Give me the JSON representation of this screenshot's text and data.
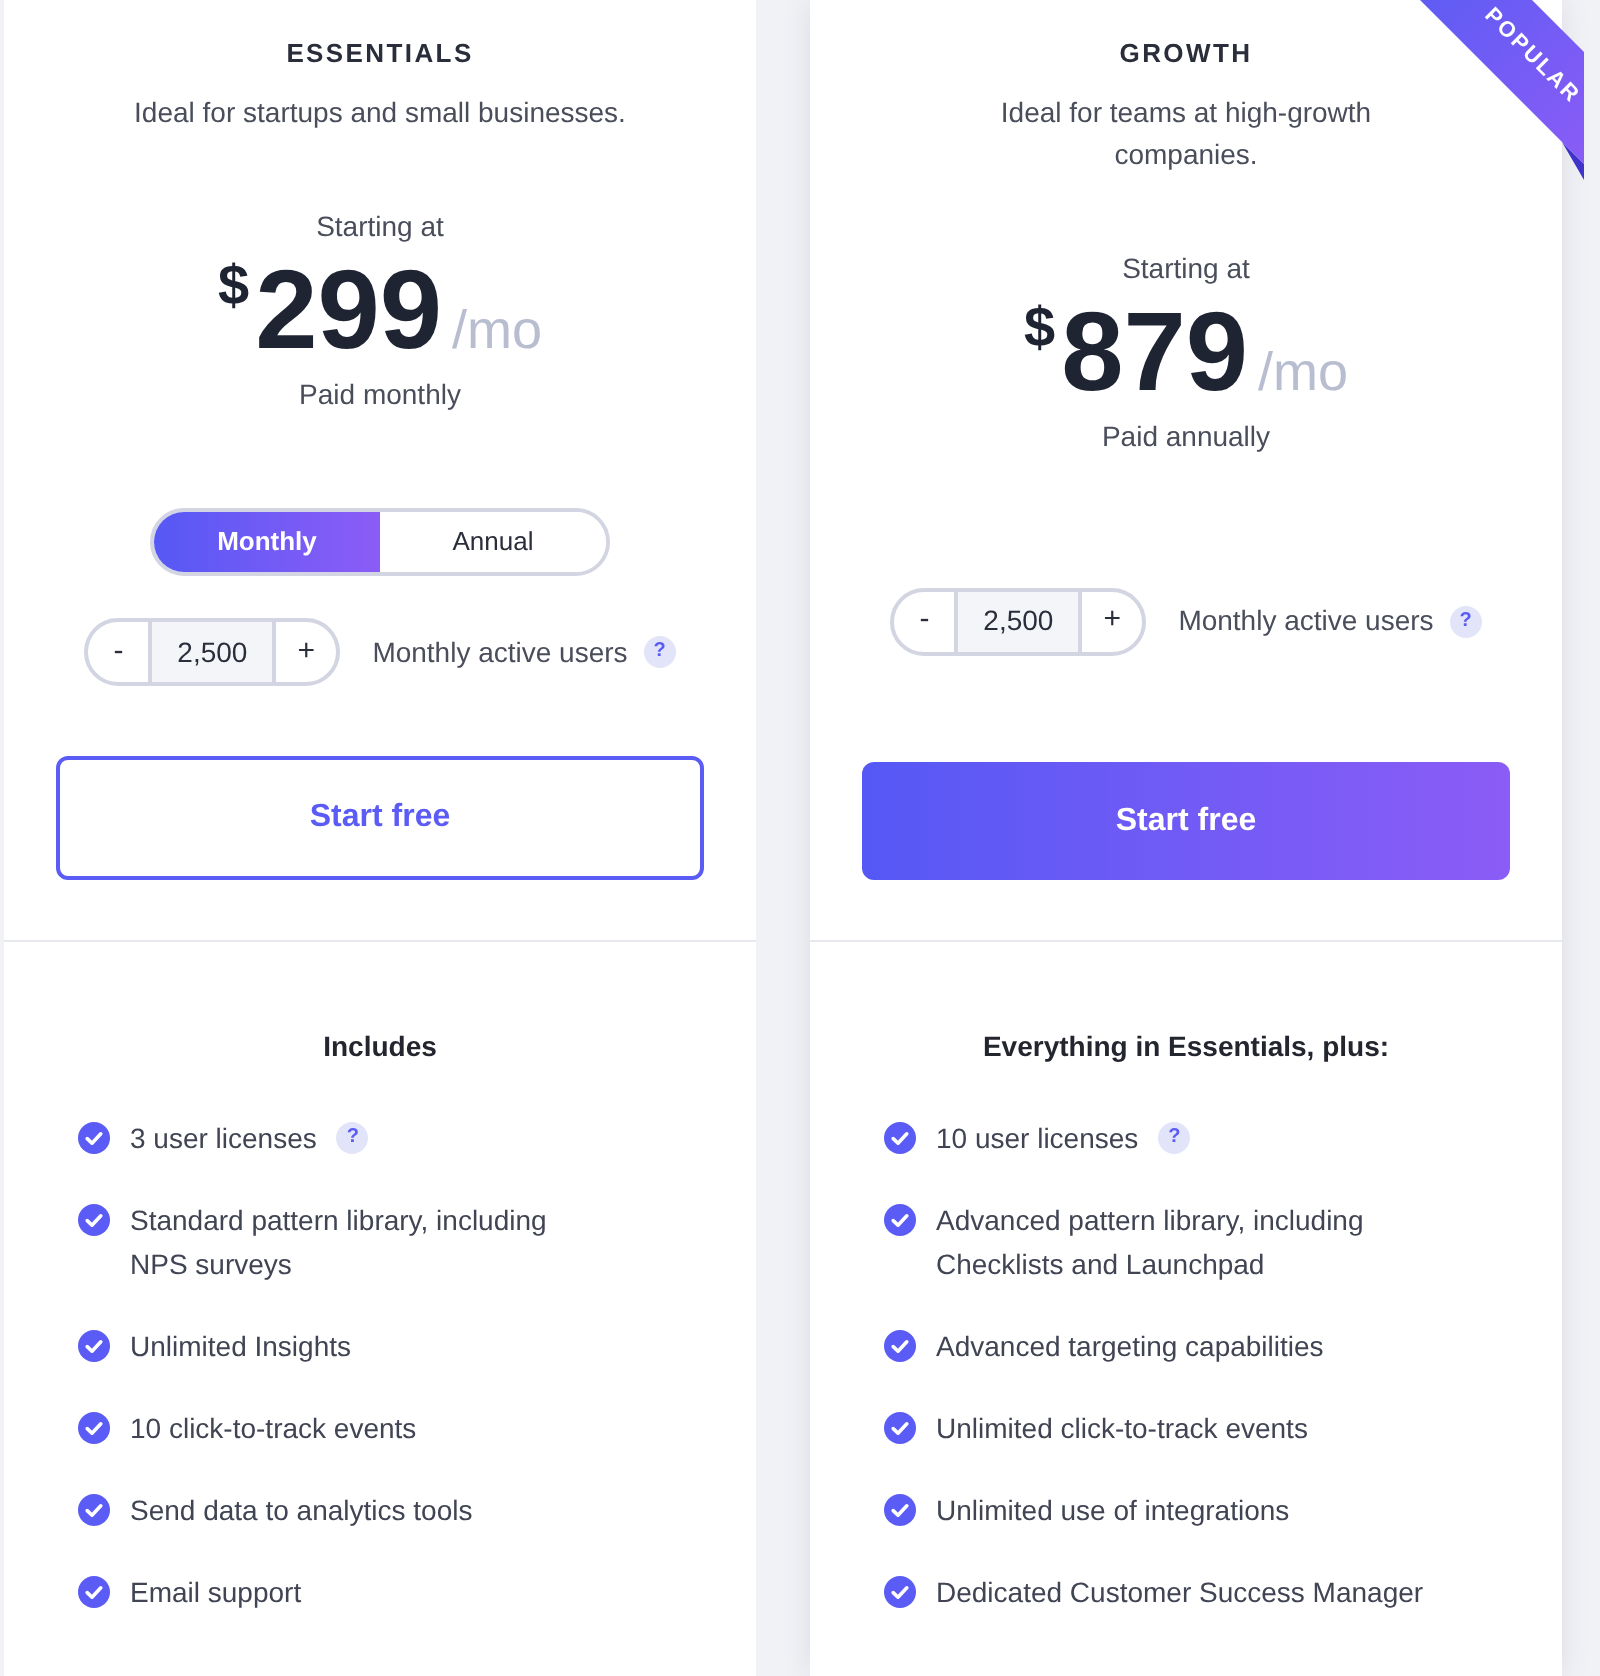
{
  "plans": [
    {
      "name": "ESSENTIALS",
      "subtitle": "Ideal for startups and small businesses.",
      "price_caption": "Starting at",
      "currency": "$",
      "price": "299",
      "period": "/mo",
      "billing_note": "Paid monthly",
      "billing_toggle": [
        {
          "label": "Monthly",
          "selected": true
        },
        {
          "label": "Annual",
          "selected": false
        }
      ],
      "users": {
        "decrement": "-",
        "value": "2,500",
        "increment": "+",
        "label": "Monthly active users",
        "help": "?"
      },
      "cta": {
        "label": "Start free",
        "kind": "outline"
      },
      "features_heading": "Includes",
      "features": [
        {
          "text": "3 user licenses",
          "help": "?"
        },
        {
          "text": "Standard pattern library, including NPS surveys"
        },
        {
          "text": "Unlimited Insights"
        },
        {
          "text": "10 click-to-track events"
        },
        {
          "text": "Send data to analytics tools"
        },
        {
          "text": "Email support"
        }
      ]
    },
    {
      "name": "GROWTH",
      "ribbon": "POPULAR",
      "subtitle": "Ideal for teams at high-growth companies.",
      "price_caption": "Starting at",
      "currency": "$",
      "price": "879",
      "period": "/mo",
      "billing_note": "Paid annually",
      "users": {
        "decrement": "-",
        "value": "2,500",
        "increment": "+",
        "label": "Monthly active users",
        "help": "?"
      },
      "cta": {
        "label": "Start free",
        "kind": "filled"
      },
      "features_heading": "Everything in Essentials, plus:",
      "features": [
        {
          "text": "10 user licenses",
          "help": "?"
        },
        {
          "text": "Advanced pattern library, including Checklists and Launchpad"
        },
        {
          "text": "Advanced targeting capabilities"
        },
        {
          "text": "Unlimited click-to-track events"
        },
        {
          "text": "Unlimited use of integrations"
        },
        {
          "text": "Dedicated Customer Success Manager"
        }
      ]
    }
  ]
}
